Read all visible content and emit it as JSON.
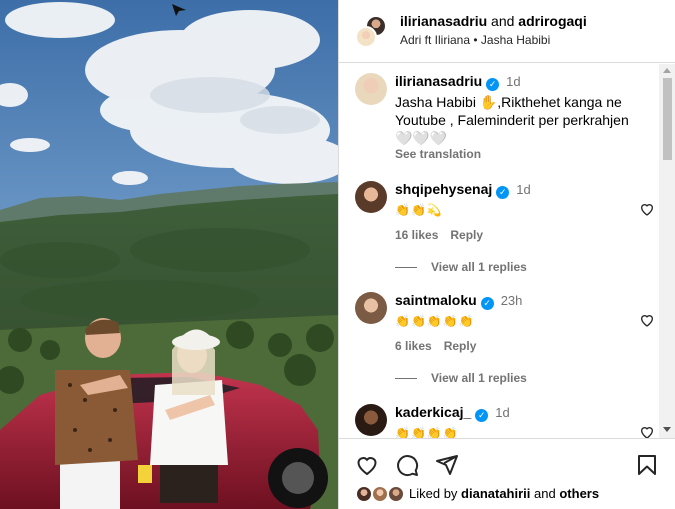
{
  "header": {
    "author1": "ilirianasadriu",
    "and": "and",
    "author2": "adrirogaqi",
    "subtitle": "Adri ft Iliriana • Jasha Habibi"
  },
  "caption": {
    "username": "ilirianasadriu",
    "time": "1d",
    "text": "Jasha Habibi ✋,Rikthehet kanga ne Youtube , Faleminderit per perkrahjen 🤍🤍🤍",
    "see_translation": "See translation"
  },
  "comments": [
    {
      "username": "shqipehysenaj",
      "time": "1d",
      "text": "👏👏💫",
      "likes": "16 likes",
      "reply": "Reply",
      "view_replies": "View all 1 replies"
    },
    {
      "username": "saintmaloku",
      "time": "23h",
      "text": "👏👏👏👏👏",
      "likes": "6 likes",
      "reply": "Reply",
      "view_replies": "View all 1 replies"
    },
    {
      "username": "kaderkicaj_",
      "time": "1d",
      "text": "👏👏👏👏"
    }
  ],
  "footer": {
    "liked_prefix": "Liked by",
    "liked_user": "dianatahirii",
    "liked_and": "and",
    "liked_others": "others"
  },
  "icons": {
    "like": "heart-icon",
    "comment": "comment-icon",
    "share": "send-icon",
    "save": "bookmark-icon"
  },
  "colors": {
    "verified": "#0095f6",
    "muted": "#737373",
    "border": "#dbdbdb"
  }
}
